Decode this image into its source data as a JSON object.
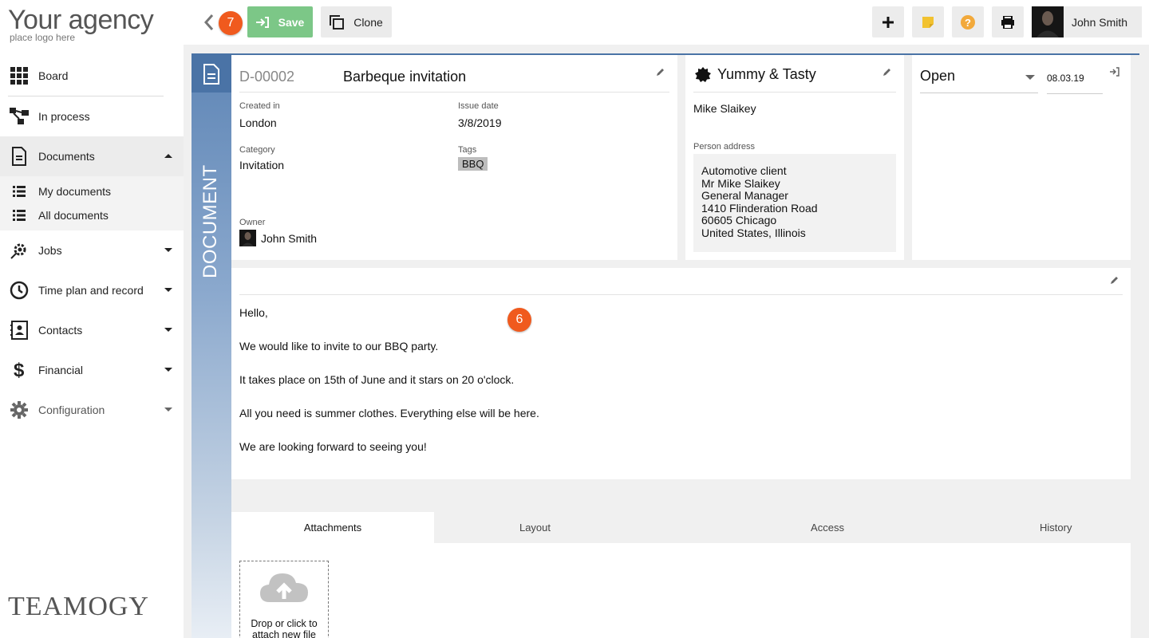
{
  "brand": {
    "logo_main": "Your agency",
    "logo_sub": "place logo here",
    "footer_logo": "TEAMOGY"
  },
  "sidebar": {
    "items": [
      {
        "label": "Board",
        "icon": "grid-icon"
      },
      {
        "label": "In process",
        "icon": "flow-icon"
      },
      {
        "label": "Documents",
        "icon": "document-icon",
        "expanded": true
      },
      {
        "label": "Jobs",
        "icon": "jobs-icon"
      },
      {
        "label": "Time plan and record",
        "icon": "clock-icon"
      },
      {
        "label": "Contacts",
        "icon": "contacts-icon"
      },
      {
        "label": "Financial",
        "icon": "dollar-icon"
      },
      {
        "label": "Configuration",
        "icon": "gear-icon"
      }
    ],
    "sub_items": [
      {
        "label": "My documents"
      },
      {
        "label": "All documents"
      }
    ]
  },
  "toolbar": {
    "save_label": "Save",
    "clone_label": "Clone",
    "step_badge": "7",
    "user_name": "John Smith"
  },
  "document": {
    "strip_label": "DOCUMENT",
    "id": "D-00002",
    "title": "Barbeque invitation",
    "created_in_label": "Created in",
    "created_in": "London",
    "issue_date_label": "Issue date",
    "issue_date": "3/8/2019",
    "category_label": "Category",
    "category": "Invitation",
    "tags_label": "Tags",
    "tag": "BBQ",
    "owner_label": "Owner",
    "owner": "John Smith"
  },
  "contact": {
    "company": "Yummy & Tasty",
    "person": "Mike Slaikey",
    "address_label": "Person address",
    "address_lines": [
      "Automotive client",
      "Mr  Mike Slaikey",
      "General Manager",
      "1410  Flinderation Road",
      "60605 Chicago",
      "United States, Illinois"
    ]
  },
  "status": {
    "value": "Open",
    "date": "08.03.19"
  },
  "body": {
    "step_badge": "6",
    "paragraphs": [
      "Hello,",
      "We would like to invite to our BBQ party.",
      "It takes place on 15th of June and it stars on 20 o'clock.",
      "All you need is summer clothes. Everything else will be here.",
      "We are looking forward to seeing you!"
    ]
  },
  "tabs": [
    {
      "label": "Attachments",
      "active": true
    },
    {
      "label": "Layout"
    },
    {
      "label": "Access"
    },
    {
      "label": "History"
    }
  ],
  "attachments": {
    "dropzone_line1": "Drop or click to",
    "dropzone_line2": "attach new file"
  },
  "colors": {
    "accent_blue": "#4a73a6",
    "save_green": "#7cc787",
    "badge_orange": "#f05a1e",
    "note_yellow": "#f2c230",
    "help_orange": "#f2a93b"
  }
}
